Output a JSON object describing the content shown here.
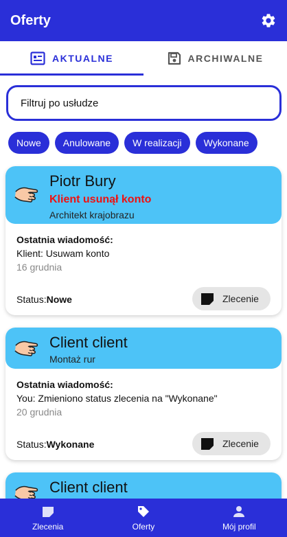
{
  "header": {
    "title": "Oferty",
    "settings_icon": "gear-icon"
  },
  "tabs": [
    {
      "label": "AKTUALNE",
      "icon": "list-card-icon",
      "active": true
    },
    {
      "label": "ARCHIWALNE",
      "icon": "save-icon",
      "active": false
    }
  ],
  "filter": {
    "placeholder": "Filtruj po usłudze"
  },
  "chips": [
    "Nowe",
    "Anulowane",
    "W realizacji",
    "Wykonane"
  ],
  "offers": [
    {
      "name": "Piotr Bury",
      "alert": "Klient usunął konto",
      "service": "Architekt krajobrazu",
      "last_message_label": "Ostatnia wiadomość:",
      "last_message": "Klient: Usuwam konto",
      "date": "16 grudnia",
      "status_label": "Status:",
      "status": "Nowe",
      "button_label": "Zlecenie"
    },
    {
      "name": "Client client",
      "service": "Montaż rur",
      "last_message_label": "Ostatnia wiadomość:",
      "last_message": "You: Zmieniono status zlecenia na \"Wykonane\"",
      "date": "20 grudnia",
      "status_label": "Status:",
      "status": "Wykonane",
      "button_label": "Zlecenie"
    },
    {
      "name": "Client client"
    }
  ],
  "bottom_nav": [
    {
      "label": "Zlecenia",
      "icon": "document-icon"
    },
    {
      "label": "Oferty",
      "icon": "tag-icon"
    },
    {
      "label": "Mój profil",
      "icon": "person-icon"
    }
  ],
  "colors": {
    "primary": "#2a2fd8",
    "card_header": "#4dc3f7",
    "alert": "#ee1111"
  }
}
